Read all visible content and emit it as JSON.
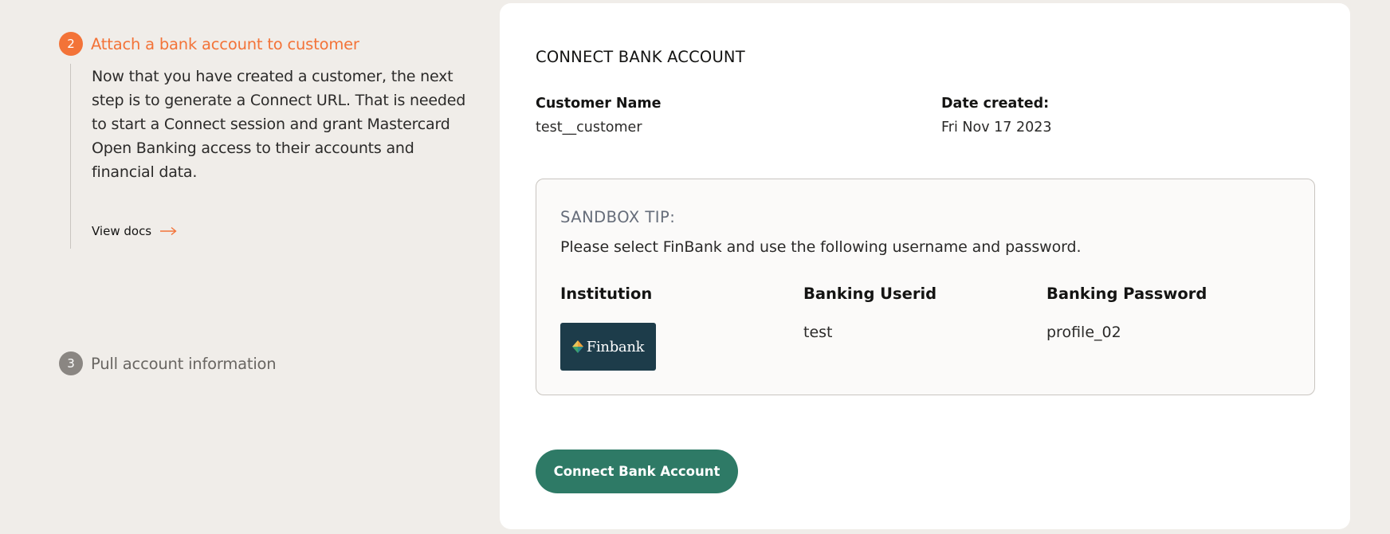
{
  "steps": {
    "active": {
      "number": "2",
      "title": "Attach a bank account to customer",
      "description": "Now that you have created a customer, the next step is to generate a Connect URL. That is needed to start a Connect session and grant Mastercard Open Banking access to their accounts and financial data.",
      "link_label": "View docs",
      "link_icon": "arrow-right-icon"
    },
    "next": {
      "number": "3",
      "title": "Pull account information"
    }
  },
  "card": {
    "title": "CONNECT BANK ACCOUNT",
    "customer_name_label": "Customer Name",
    "customer_name_value": "test__customer",
    "date_label": "Date created:",
    "date_value": "Fri Nov 17 2023",
    "tip": {
      "title": "SANDBOX TIP:",
      "text": "Please select FinBank and use the following username and password.",
      "columns": {
        "institution": "Institution",
        "userid": "Banking Userid",
        "password": "Banking Password"
      },
      "institution_logo_text": "Finbank",
      "userid_value": "test",
      "password_value": "profile_02"
    },
    "button_label": "Connect Bank Account"
  },
  "colors": {
    "accent_orange": "#f37338",
    "button_green": "#2e7a66",
    "background": "#f0ede9",
    "logo_bg": "#1d3c4a"
  }
}
